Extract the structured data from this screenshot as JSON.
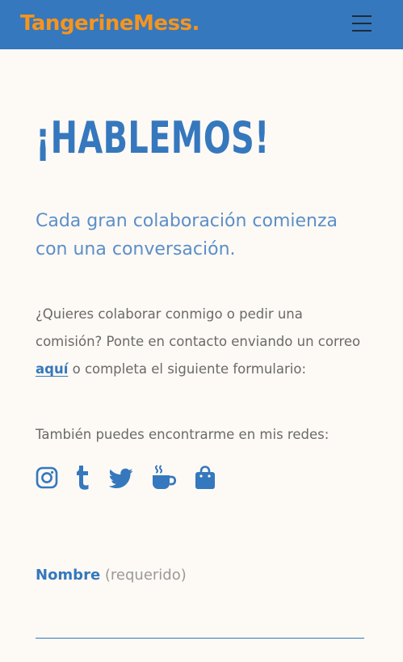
{
  "header": {
    "brand": "TangerineMess.",
    "menu_icon": "hamburger-menu-icon",
    "background": "#3578bd",
    "brand_color": "#f7941d"
  },
  "main": {
    "title": "¡HABLEMOS!",
    "lead": "Cada gran colaboración comienza con una conversación.",
    "intro_before_link": "¿Quieres colaborar conmigo o pedir una comisión? Ponte en contacto enviando un correo ",
    "intro_link": "aquí",
    "intro_after_link": " o completa el siguiente formulario:",
    "social_intro": "También puedes encontrarme en mis redes:",
    "socials": [
      {
        "icon": "instagram-icon"
      },
      {
        "icon": "tumblr-icon"
      },
      {
        "icon": "twitter-icon"
      },
      {
        "icon": "ko-fi-cup-icon"
      },
      {
        "icon": "shopping-bag-icon"
      }
    ],
    "accent_color": "#3578bd"
  },
  "form": {
    "name_label": "Nombre",
    "name_required": "(requerido)",
    "name_value": ""
  }
}
